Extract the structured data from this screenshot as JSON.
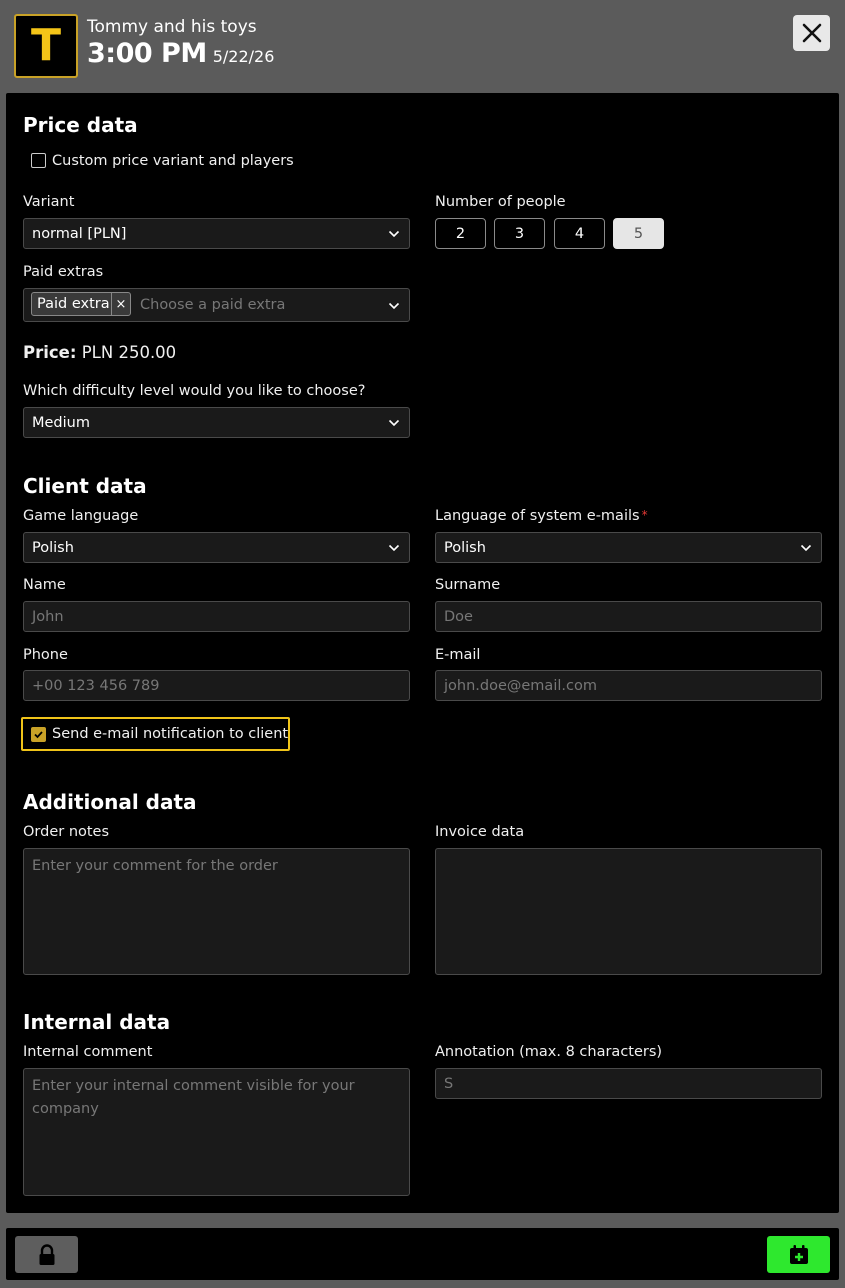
{
  "header": {
    "logo_letter": "T",
    "game_title": "Tommy and his toys",
    "time": "3:00 PM",
    "date": "5/22/26"
  },
  "price": {
    "section_title": "Price data",
    "custom_checkbox_label": "Custom price variant and players",
    "variant_label": "Variant",
    "variant_value": "normal [PLN]",
    "people_label": "Number of people",
    "people_options": [
      "2",
      "3",
      "4",
      "5"
    ],
    "people_selected": "5",
    "extras_label": "Paid extras",
    "extras_tag": "Paid extra",
    "extras_tag_remove": "×",
    "extras_placeholder": "Choose a paid extra",
    "price_label": "Price:",
    "price_value": "PLN 250.00",
    "difficulty_label": "Which difficulty level would you like to choose?",
    "difficulty_value": "Medium"
  },
  "client": {
    "section_title": "Client data",
    "game_language_label": "Game language",
    "game_language_value": "Polish",
    "email_language_label": "Language of system e-mails",
    "email_language_required": "*",
    "email_language_value": "Polish",
    "name_label": "Name",
    "name_placeholder": "John",
    "surname_label": "Surname",
    "surname_placeholder": "Doe",
    "phone_label": "Phone",
    "phone_placeholder": "+00 123 456 789",
    "email_label": "E-mail",
    "email_placeholder": "john.doe@email.com",
    "notify_label": "Send e-mail notification to client"
  },
  "additional": {
    "section_title": "Additional data",
    "order_notes_label": "Order notes",
    "order_notes_placeholder": "Enter your comment for the order",
    "invoice_label": "Invoice data"
  },
  "internal": {
    "section_title": "Internal data",
    "comment_label": "Internal comment",
    "comment_placeholder": "Enter your internal comment visible for your company",
    "annotation_label": "Annotation (max. 8 characters)",
    "annotation_value": "S"
  },
  "colors": {
    "accent": "#f0c419",
    "confirm": "#2ee82e",
    "required": "#e53935"
  }
}
